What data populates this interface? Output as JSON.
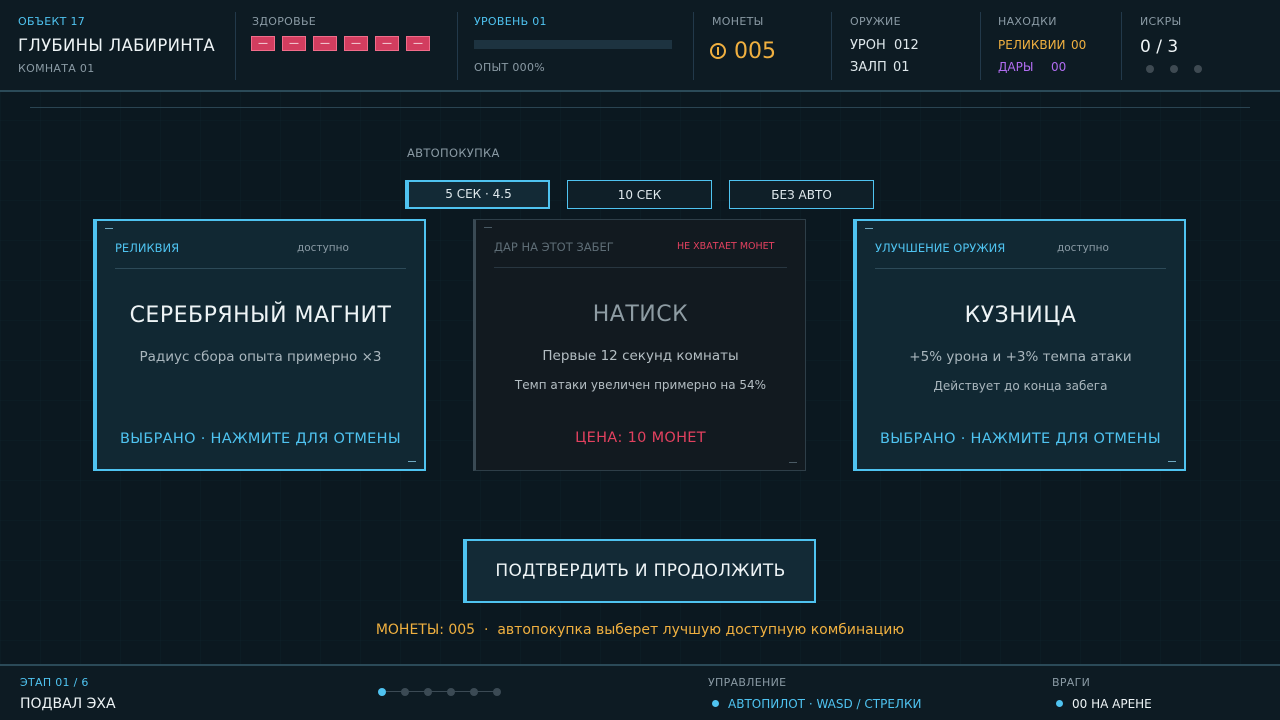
{
  "object": {
    "label": "ОБЪЕКТ 17",
    "title": "ГЛУБИНЫ ЛАБИРИНТА",
    "room": "КОМНАТА 01"
  },
  "health": {
    "label": "ЗДОРОВЬЕ",
    "pips": [
      "—",
      "—",
      "—",
      "—",
      "—",
      "—"
    ]
  },
  "level": {
    "label": "УРОВЕНЬ 01",
    "xp": "ОПЫТ 000%",
    "xp_fraction": 0.0
  },
  "coins": {
    "label": "МОНЕТЫ",
    "icon": "coin-icon",
    "value": "005"
  },
  "weapon": {
    "label": "ОРУЖИЕ",
    "damage_label": "УРОН",
    "damage": "012",
    "volley_label": "ЗАЛП",
    "volley": "01"
  },
  "finds": {
    "label": "НАХОДКИ",
    "relics_label": "РЕЛИКВИИ",
    "relics": "00",
    "gifts_label": "ДАРЫ",
    "gifts": "00"
  },
  "sparks": {
    "label": "ИСКРЫ",
    "value": "0 / 3"
  },
  "autobuy": {
    "label": "АВТОПОКУПКА",
    "options": [
      "5 СЕК · 4.5",
      "10 СЕК",
      "БЕЗ АВТО"
    ]
  },
  "cards": [
    {
      "type": "РЕЛИКВИЯ",
      "status": "доступно",
      "title": "СЕРЕБРЯНЫЙ МАГНИТ",
      "desc": "Радиус сбора опыта примерно ×3",
      "desc2": "",
      "action": "ВЫБРАНО · НАЖМИТЕ ДЛЯ ОТМЕНЫ"
    },
    {
      "type": "ДАР НА ЭТОТ ЗАБЕГ",
      "status": "НЕ ХВАТАЕТ МОНЕТ",
      "title": "НАТИСК",
      "desc": "Первые 12 секунд комнаты",
      "desc2": "Темп атаки увеличен примерно на 54%",
      "action": "ЦЕНА: 10 МОНЕТ"
    },
    {
      "type": "УЛУЧШЕНИЕ ОРУЖИЯ",
      "status": "доступно",
      "title": "КУЗНИЦА",
      "desc": "+5% урона и +3% темпа атаки",
      "desc2": "Действует до конца забега",
      "action": "ВЫБРАНО · НАЖМИТЕ ДЛЯ ОТМЕНЫ"
    }
  ],
  "confirm_label": "ПОДТВЕРДИТЬ И ПРОДОЛЖИТЬ",
  "hint": "МОНЕТЫ: 005  ·  автопокупка выберет лучшую доступную комбинацию",
  "stage": {
    "label": "ЭТАП 01 / 6",
    "name": "ПОДВАЛ ЭХА"
  },
  "controls": {
    "label": "УПРАВЛЕНИЕ",
    "value": "АВТОПИЛОТ · WASD / СТРЕЛКИ"
  },
  "enemies": {
    "label": "ВРАГИ",
    "value": "00 НА АРЕНЕ"
  },
  "colors": {
    "accent": "#4fc3f0",
    "gold": "#f0b040",
    "danger": "#e2415f",
    "gift": "#b06cf0"
  }
}
